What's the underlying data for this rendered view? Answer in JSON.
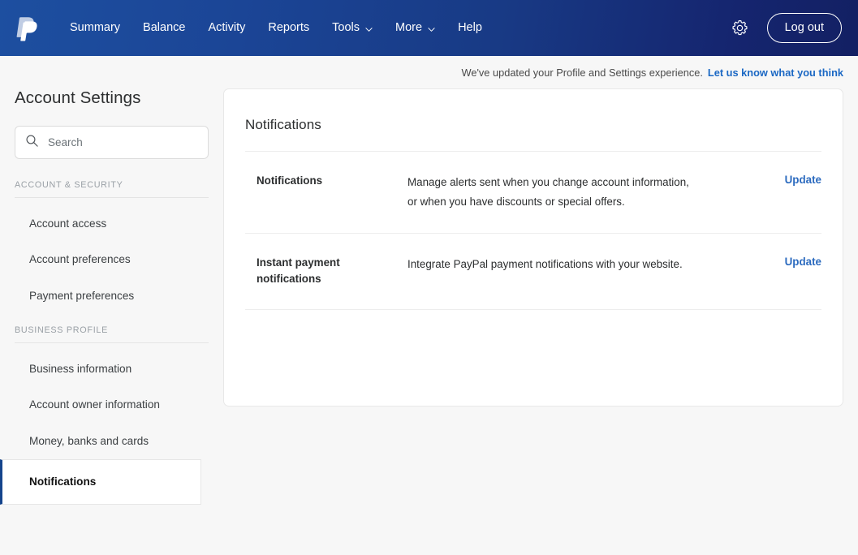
{
  "header": {
    "logo_icon": "paypal-logo-icon",
    "nav": [
      {
        "label": "Summary",
        "has_chevron": false
      },
      {
        "label": "Balance",
        "has_chevron": false
      },
      {
        "label": "Activity",
        "has_chevron": false
      },
      {
        "label": "Reports",
        "has_chevron": false
      },
      {
        "label": "Tools",
        "has_chevron": true
      },
      {
        "label": "More",
        "has_chevron": true
      },
      {
        "label": "Help",
        "has_chevron": false
      }
    ],
    "settings_icon": "gear-icon",
    "logout_label": "Log out"
  },
  "banner": {
    "text": "We've updated your Profile and Settings experience.",
    "link_label": "Let us know what you think"
  },
  "sidebar": {
    "title": "Account Settings",
    "search": {
      "placeholder": "Search",
      "value": "",
      "icon": "search-icon"
    },
    "sections": [
      {
        "heading": "ACCOUNT & SECURITY",
        "items": [
          {
            "label": "Account access",
            "active": false
          },
          {
            "label": "Account preferences",
            "active": false
          },
          {
            "label": "Payment preferences",
            "active": false
          }
        ]
      },
      {
        "heading": "BUSINESS PROFILE",
        "items": [
          {
            "label": "Business information",
            "active": false
          },
          {
            "label": "Account owner information",
            "active": false
          },
          {
            "label": "Money, banks and cards",
            "active": false
          },
          {
            "label": "Notifications",
            "active": true
          }
        ]
      }
    ]
  },
  "main": {
    "title": "Notifications",
    "rows": [
      {
        "label": "Notifications",
        "description": "Manage alerts sent when you change account information, or when you have discounts or special offers.",
        "action_label": "Update"
      },
      {
        "label": "Instant payment notifications",
        "description": "Integrate PayPal payment notifications with your website.",
        "action_label": "Update"
      }
    ]
  },
  "colors": {
    "header_gradient_start": "#1d4fa0",
    "header_gradient_end": "#132063",
    "link_blue": "#2c6bbf",
    "banner_link_blue": "#1b68c4",
    "active_accent": "#14448c",
    "page_background": "#f7f7f7"
  }
}
